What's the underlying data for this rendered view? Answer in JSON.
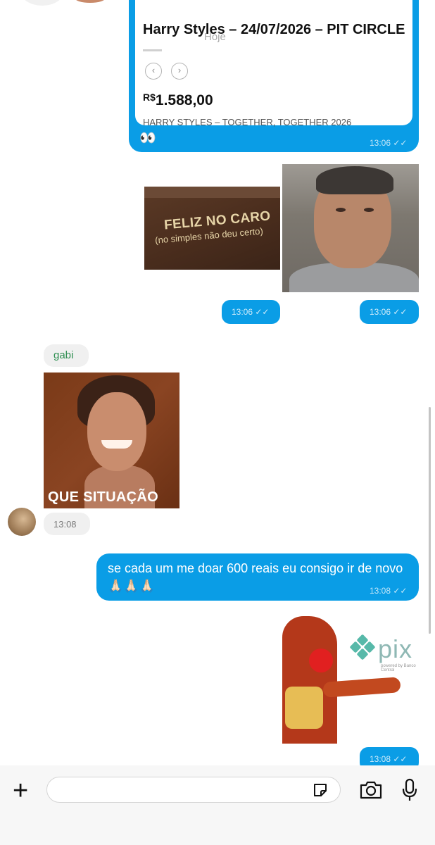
{
  "date_separator": "Hoje",
  "link_card": {
    "title": "Harry Styles – 24/07/2026 – PIT CIRCLE",
    "currency": "R$",
    "price": "1.588,00",
    "subtitle": "HARRY STYLES – TOGETHER, TOGETHER 2026",
    "prev_icon": "‹",
    "next_icon": "›",
    "comment": "👀",
    "time": "13:06 ✓✓"
  },
  "media_outgoing": {
    "cap_text_line1": "FELIZ NO CARO",
    "cap_text_line2": "(no simples não deu certo)",
    "time_1": "13:06 ✓✓",
    "time_2": "13:06 ✓✓"
  },
  "incoming": {
    "sender": "gabi",
    "image_caption": "QUE SITUAÇÃO",
    "time": "13:08"
  },
  "text_message": {
    "text": "se cada um me doar 600 reais eu consigo ir de novo 🙏🏻🙏🏻🙏🏻",
    "time": "13:08 ✓✓"
  },
  "pix_image": {
    "logo_text": "pix",
    "logo_sub": "powered by Banco Central"
  },
  "pix_time": "13:08 ✓✓",
  "composer": {
    "plus_icon": "+",
    "placeholder": "",
    "icons": [
      "sticker-icon",
      "camera-icon",
      "microphone-icon"
    ]
  },
  "colors": {
    "outgoing_bubble": "#0a9de6",
    "incoming_bubble": "#f0f0f0",
    "sender_name": "#2f8f52"
  }
}
